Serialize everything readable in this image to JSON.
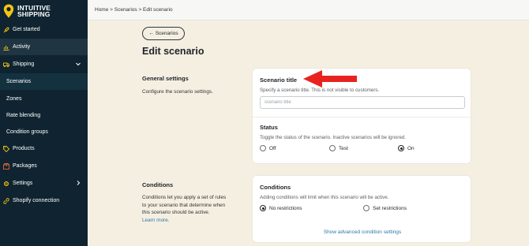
{
  "brand": {
    "name_line1": "INTUITIVE",
    "name_line2": "SHIPPING",
    "accent": "#f3c316"
  },
  "sidebar": {
    "items": [
      {
        "label": "Get started",
        "icon": "rocket-icon"
      },
      {
        "label": "Activity",
        "icon": "activity-chart-icon"
      },
      {
        "label": "Shipping",
        "icon": "truck-icon"
      },
      {
        "label": "Scenarios"
      },
      {
        "label": "Zones"
      },
      {
        "label": "Rate blending"
      },
      {
        "label": "Condition groups"
      },
      {
        "label": "Products",
        "icon": "tag-icon"
      },
      {
        "label": "Packages",
        "icon": "package-icon"
      },
      {
        "label": "Settings",
        "icon": "gear-icon"
      },
      {
        "label": "Shopify connection",
        "icon": "link-icon"
      }
    ]
  },
  "breadcrumb": "Home > Scenarios > Edit scenario",
  "back_button": "← Scenarios",
  "page_title": "Edit scenario",
  "general": {
    "title": "General settings",
    "desc": "Configure the scenario settings.",
    "scenario_title_label": "Scenario title",
    "scenario_title_help": "Specify a scenario title. This is not visible to customers.",
    "scenario_title_placeholder": "scenario title",
    "status_label": "Status",
    "status_help": "Toggle the status of the scenario. Inactive scenarios will be ignored.",
    "status_options": [
      "Off",
      "Test",
      "On"
    ],
    "status_selected": "On"
  },
  "conditions": {
    "title": "Conditions",
    "desc_lines": [
      "Conditions let you apply a set of rules",
      "to your scenario that determine when",
      "this scenario should be active."
    ],
    "learn_more": "Learn more.",
    "card_title": "Conditions",
    "card_help": "Adding conditions will limit when this scenario will be active.",
    "options": [
      "No restrictions",
      "Set restrictions"
    ],
    "selected": "No restrictions",
    "advanced_link": "Show advanced condition settings"
  },
  "annotation_arrow_color": "#e8231f"
}
